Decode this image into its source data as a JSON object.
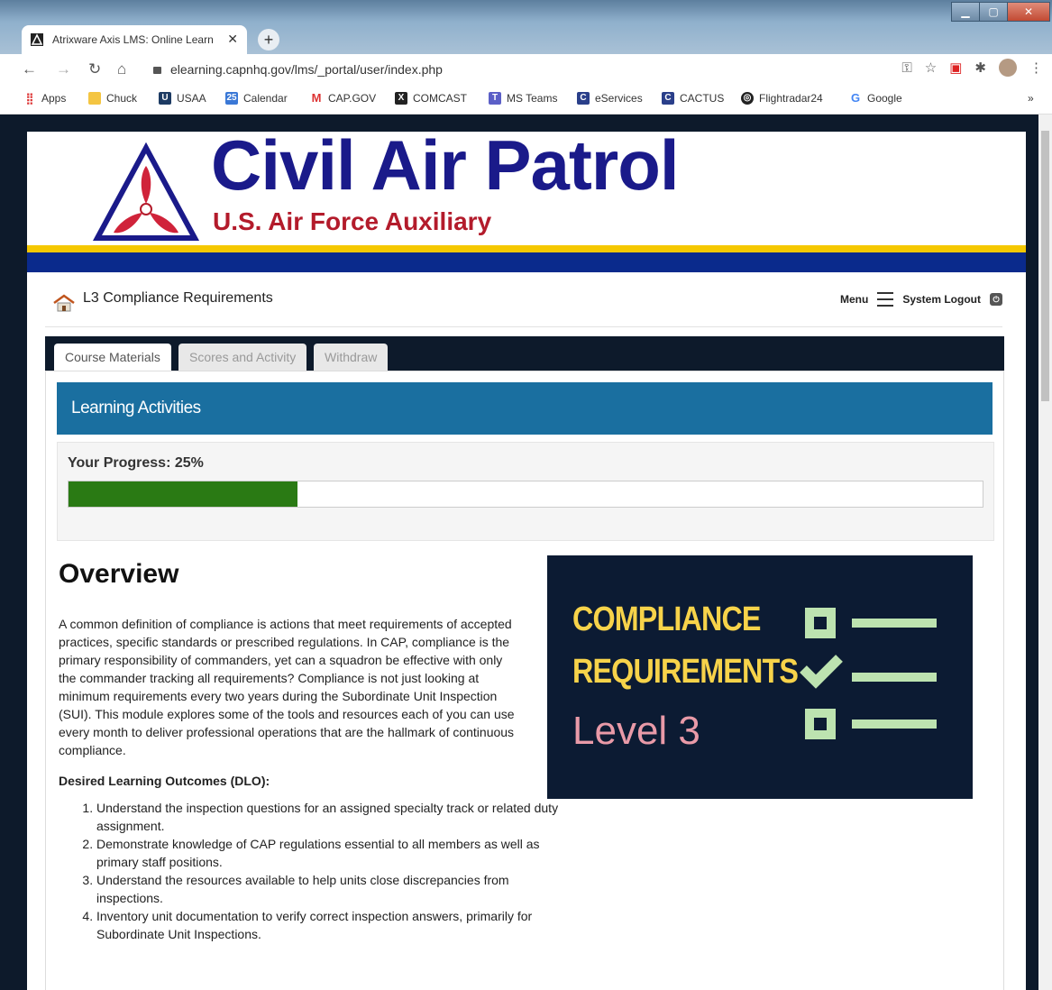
{
  "browser": {
    "tab_title": "Atrixware Axis LMS: Online Learn",
    "url": "elearning.capnhq.gov/lms/_portal/user/index.php",
    "bookmarks": [
      "Apps",
      "Chuck",
      "USAA",
      "Calendar",
      "CAP.GOV",
      "COMCAST",
      "MS Teams",
      "eServices",
      "CACTUS",
      "Flightradar24",
      "Google"
    ],
    "more": "»"
  },
  "brand": {
    "title": "Civil Air Patrol",
    "subtitle": "U.S. Air Force Auxiliary",
    "colors": {
      "navy": "#1a1a8a",
      "red": "#b31b2b",
      "yellow": "#f5c800",
      "blue": "#0a2a8c"
    }
  },
  "header": {
    "course_title": "L3 Compliance Requirements",
    "menu_label": "Menu",
    "logout_label": "System Logout"
  },
  "tabs": [
    {
      "label": "Course Materials",
      "active": true
    },
    {
      "label": "Scores and Activity",
      "active": false
    },
    {
      "label": "Withdraw",
      "active": false
    }
  ],
  "activities": {
    "heading": "Learning Activities",
    "progress_label": "Your Progress: 25%",
    "progress_percent": 25
  },
  "overview": {
    "heading": "Overview",
    "paragraph": "A common definition of compliance is actions that meet requirements of accepted practices, specific standards or prescribed regulations. In CAP, compliance is the primary responsibility of commanders, yet can a squadron be effective with only the commander tracking all requirements? Compliance is not just looking at minimum requirements every two years during the Subordinate Unit Inspection (SUI).  This module explores some of the tools and resources each of you can use every month to deliver professional operations that are the hallmark of continuous compliance.",
    "dlo_heading": "Desired Learning Outcomes (DLO):",
    "dlo_items": [
      "Understand the inspection questions for an assigned specialty track or related duty assignment.",
      "Demonstrate knowledge of CAP regulations essential to all members as well as primary staff positions.",
      "Understand the resources available to help units close discrepancies from inspections.",
      "Inventory unit documentation to verify correct inspection answers, primarily for Subordinate Unit Inspections."
    ]
  },
  "banner": {
    "line1": "COMPLIANCE",
    "line2": "REQUIREMENTS",
    "line3": "Level 3"
  }
}
